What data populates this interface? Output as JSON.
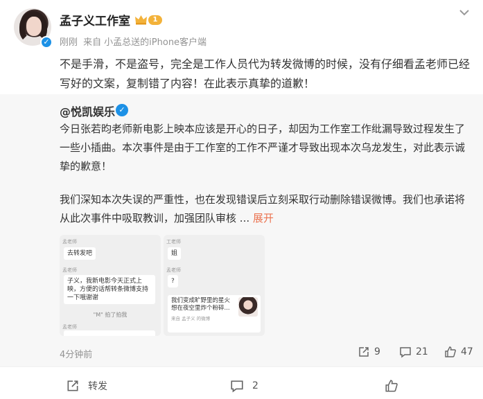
{
  "post": {
    "username": "孟子义工作室",
    "level": "1",
    "time": "刚刚",
    "source_prefix": "来自",
    "source": "小孟总送的iPhone客户端",
    "text": "不是手滑，不是盗号，完全是工作人员代为转发微博的时候，没有仔细看孟老师已经写好的文案，复制错了内容！在此表示真挚的道歉！"
  },
  "repost": {
    "username": "@悦凯娱乐",
    "text1": "今日张若昀老师新电影上映本应该是开心的日子，却因为工作室工作纰漏导致过程发生了一些小插曲。本次事件是由于工作室的工作不严谨才导致出现本次乌龙发生，对此表示诚挚的歉意！",
    "text2": "我们深知本次失误的严重性，也在发现错误后立刻采取行动删除错误微博。我们也承诺将从此次事件中吸取教训，加强团队审核",
    "ellipsis": "...",
    "expand": "展开",
    "time": "4分钟前",
    "reposts": "9",
    "comments": "21",
    "likes": "47",
    "thumb1": {
      "label1": "孟老师",
      "msg1": "去转发吧",
      "label2": "孟老师",
      "msg2": "子义，我新电影今天正式上映，方便的话帮转条微博支持一下哦谢谢",
      "note": "\"M\" 拍了拍我",
      "label3": "孟老师"
    },
    "thumb2": {
      "label1": "工老师",
      "msg1": "姐",
      "label2": "孟老师",
      "msg2": "?",
      "card_text": "我们变成旷野里的星火 想在夜空里炸个粉碎...",
      "card_source": "来自 孟子义 的微博"
    }
  },
  "bottom": {
    "forward": "转发",
    "comments": "2",
    "likes": ""
  },
  "colors": {
    "accent": "#eb7350",
    "verified": "#1d91e6",
    "badge": "#f3b23a"
  }
}
